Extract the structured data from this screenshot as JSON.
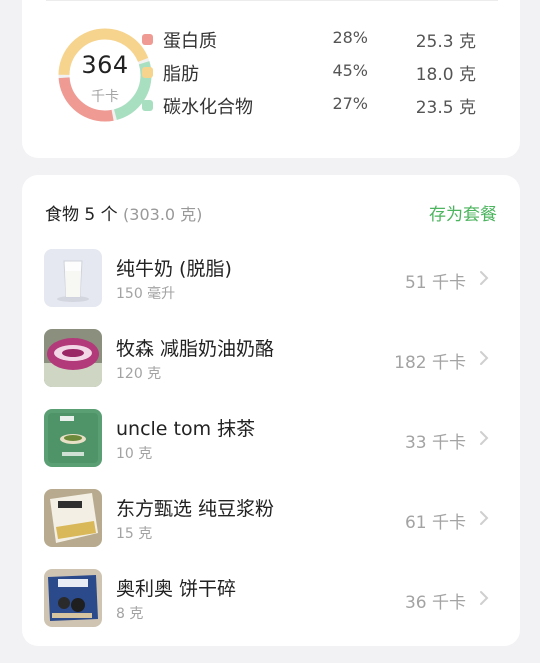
{
  "summary": {
    "calories": "364",
    "calories_unit": "千卡",
    "macros": [
      {
        "name": "蛋白质",
        "percent": "28%",
        "amount": "25.3 克",
        "color": "#ef9a93"
      },
      {
        "name": "脂肪",
        "percent": "45%",
        "amount": "18.0 克",
        "color": "#f7d48d"
      },
      {
        "name": "碳水化合物",
        "percent": "27%",
        "amount": "23.5 克",
        "color": "#a9dfc1"
      }
    ]
  },
  "foods": {
    "header_label": "食物 5 个",
    "header_weight": "(303.0 克)",
    "save_label": "存为套餐",
    "items": [
      {
        "name": "纯牛奶 (脱脂)",
        "amount": "150 毫升",
        "kcal": "51 千卡",
        "icon": "milk-glass-thumbnail"
      },
      {
        "name": "牧森 减脂奶油奶酪",
        "amount": "120 克",
        "kcal": "182 千卡",
        "icon": "cream-cheese-thumbnail"
      },
      {
        "name": "uncle tom 抹茶",
        "amount": "10 克",
        "kcal": "33 千卡",
        "icon": "matcha-pack-thumbnail"
      },
      {
        "name": "东方甄选 纯豆浆粉",
        "amount": "15 克",
        "kcal": "61 千卡",
        "icon": "soy-powder-thumbnail"
      },
      {
        "name": "奥利奥 饼干碎",
        "amount": "8 克",
        "kcal": "36 千卡",
        "icon": "oreo-crumbs-thumbnail"
      }
    ]
  }
}
